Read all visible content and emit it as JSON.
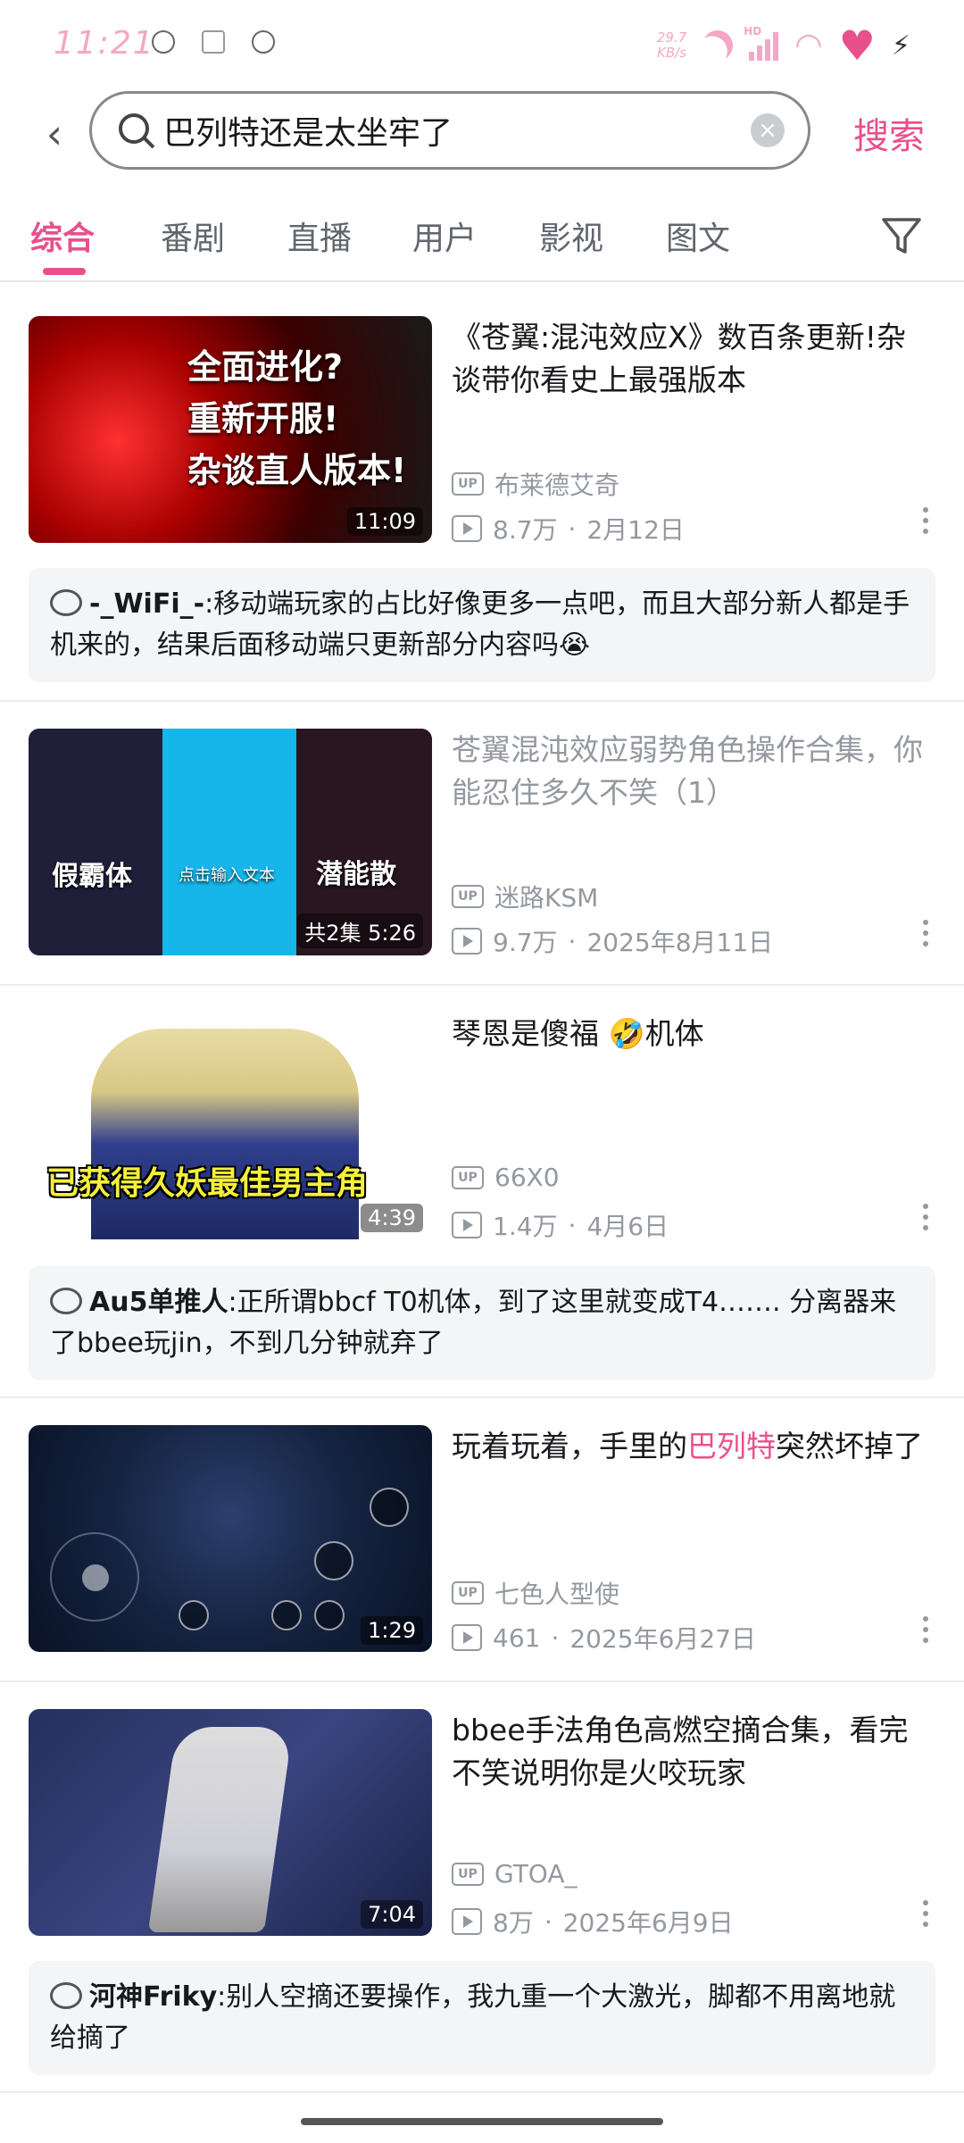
{
  "status_bar": {
    "time": "11:21",
    "net_speed": "29.7\nKB/s",
    "hd_label": "HD"
  },
  "search": {
    "query": "巴列特还是太坐牢了",
    "submit_label": "搜索"
  },
  "tabs": [
    {
      "label": "综合",
      "active": true
    },
    {
      "label": "番剧"
    },
    {
      "label": "直播"
    },
    {
      "label": "用户"
    },
    {
      "label": "影视"
    },
    {
      "label": "图文"
    }
  ],
  "results": [
    {
      "thumb_text": [
        "全面进化?",
        "重新开服!",
        "杂谈直人版本!"
      ],
      "duration": "11:09",
      "title": "《苍翼:混沌效应X》数百条更新!杂谈带你看史上最强版本",
      "uploader": "布莱德艾奇",
      "views": "8.7万",
      "date": "2月12日",
      "comment": {
        "user": "-_WiFi_-",
        "text": ":移动端玩家的占比好像更多一点吧，而且大部分新人都是手机来的，结果后面移动端只更新部分内容吗😭"
      }
    },
    {
      "thumb_labels": [
        "假霸体",
        "点击输入文本",
        "潜能散"
      ],
      "duration": "共2集 5:26",
      "title": "苍翼混沌效应弱势角色操作合集，你能忍住多久不笑（1）",
      "uploader": "迷路KSM",
      "views": "9.7万",
      "date": "2025年8月11日"
    },
    {
      "thumb_caption": "已获得久妖最佳男主角",
      "duration": "4:39",
      "title": "琴恩是傻福 🤣机体",
      "uploader": "66X0",
      "views": "1.4万",
      "date": "4月6日",
      "comment": {
        "user": "Au5单推人",
        "text": ":正所谓bbcf T0机体，到了这里就变成T4……. 分离器来了bbee玩jin，不到几分钟就弃了"
      }
    },
    {
      "duration": "1:29",
      "title_parts": [
        "玩着玩着，手里的",
        "巴列特",
        "突然坏掉了"
      ],
      "uploader": "七色人型使",
      "views": "461",
      "date": "2025年6月27日"
    },
    {
      "duration": "7:04",
      "title": "bbee手法角色高燃空摘合集，看完不笑说明你是火咬玩家",
      "uploader": "GTOA_",
      "views": "8万",
      "date": "2025年6月9日",
      "comment": {
        "user": "河神Friky",
        "text": ":别人空摘还要操作，我九重一个大激光，脚都不用离地就给摘了"
      }
    }
  ],
  "meta_separator": "·",
  "up_badge": "UP",
  "colors": {
    "accent": "#e8508c",
    "muted": "#9499a0",
    "comment_bg": "#f4f5f7"
  },
  "icons": [
    "back-arrow-icon",
    "search-icon",
    "clear-icon",
    "filter-icon",
    "up-icon",
    "play-count-icon",
    "more-icon",
    "comment-icon"
  ]
}
